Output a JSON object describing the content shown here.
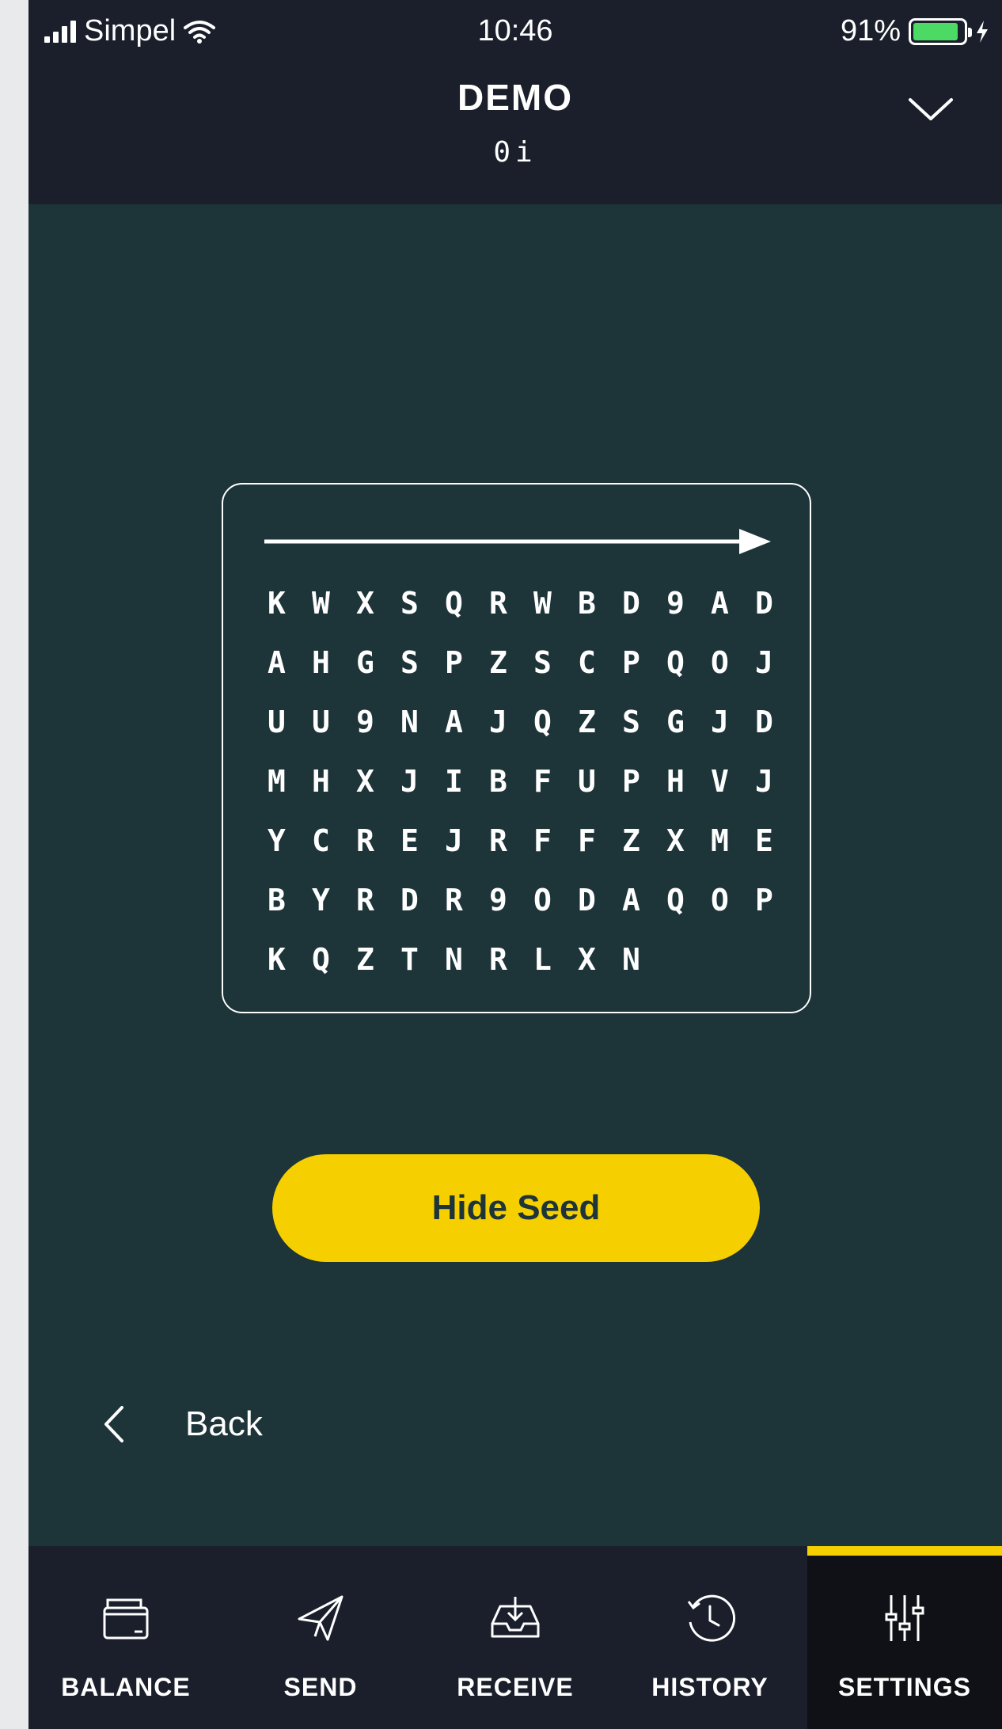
{
  "status_bar": {
    "carrier": "Simpel",
    "time": "10:46",
    "battery_percent": "91%",
    "battery_level": 0.91
  },
  "header": {
    "title": "DEMO",
    "subtitle": "0i"
  },
  "seed": {
    "rows": [
      [
        "KWX",
        "SQR",
        "WBD",
        "9AD"
      ],
      [
        "AHG",
        "SPZ",
        "SCP",
        "QOJ"
      ],
      [
        "UU9",
        "NAJ",
        "QZS",
        "GJD"
      ],
      [
        "MHX",
        "JIB",
        "FUP",
        "HVJ"
      ],
      [
        "YCR",
        "EJR",
        "FFZ",
        "XME"
      ],
      [
        "BYR",
        "DR9",
        "ODA",
        "QOP"
      ],
      [
        "KQZ",
        "TNR",
        "LXN",
        ""
      ]
    ]
  },
  "actions": {
    "hide_seed_label": "Hide Seed",
    "back_label": "Back"
  },
  "tabs": [
    {
      "label": "BALANCE",
      "icon": "wallet-icon",
      "active": false
    },
    {
      "label": "SEND",
      "icon": "paper-plane-icon",
      "active": false
    },
    {
      "label": "RECEIVE",
      "icon": "inbox-download-icon",
      "active": false
    },
    {
      "label": "HISTORY",
      "icon": "history-clock-icon",
      "active": false
    },
    {
      "label": "SETTINGS",
      "icon": "sliders-icon",
      "active": true
    }
  ],
  "colors": {
    "background": "#1d3439",
    "header": "#1a1f2b",
    "accent": "#f5cf00",
    "battery": "#4cd964"
  }
}
